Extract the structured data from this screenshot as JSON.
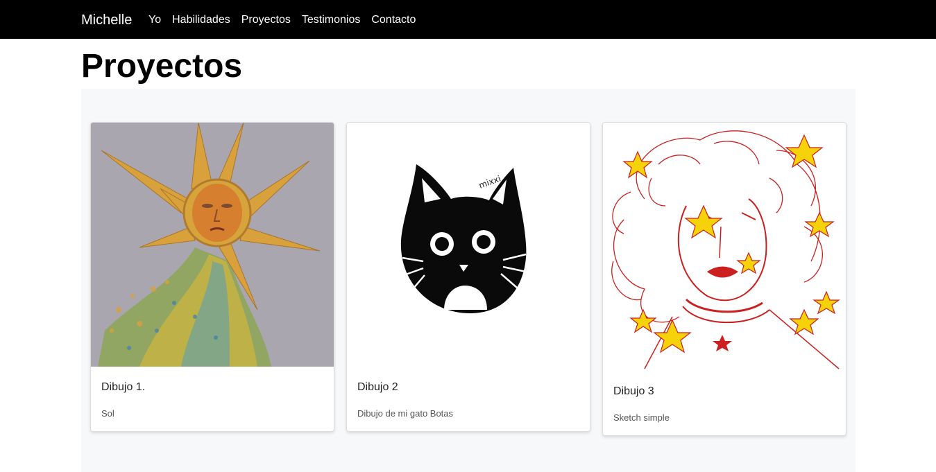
{
  "navbar": {
    "brand": "Michelle",
    "links": [
      "Yo",
      "Habilidades",
      "Proyectos",
      "Testimonios",
      "Contacto"
    ]
  },
  "page_title": "Proyectos",
  "cards": [
    {
      "title": "Dibujo 1.",
      "text": "Sol",
      "image": "sun-figure-painting"
    },
    {
      "title": "Dibujo 2",
      "text": "Dibujo de mi gato Botas",
      "image": "black-cat-drawing"
    },
    {
      "title": "Dibujo 3",
      "text": "Sketch simple",
      "image": "red-sketch-woman-stars"
    }
  ],
  "colors": {
    "navbar_bg": "#000000",
    "gallery_bg": "#f7f8fa",
    "sketch_red": "#cc1f1f",
    "star_yellow": "#f5d20a"
  }
}
